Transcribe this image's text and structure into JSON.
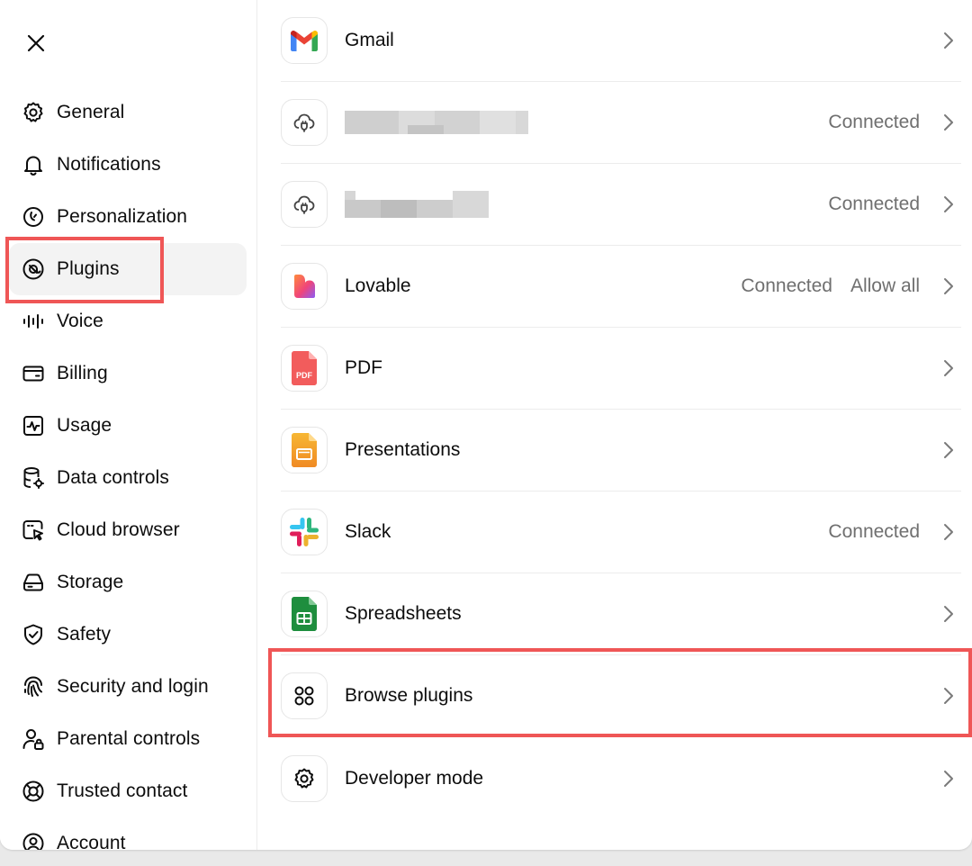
{
  "sidebar": {
    "items": [
      {
        "key": "general",
        "label": "General",
        "icon": "gear-icon"
      },
      {
        "key": "notifications",
        "label": "Notifications",
        "icon": "bell-icon"
      },
      {
        "key": "personalization",
        "label": "Personalization",
        "icon": "personalization-icon"
      },
      {
        "key": "plugins",
        "label": "Plugins",
        "icon": "plugins-icon",
        "active": true
      },
      {
        "key": "voice",
        "label": "Voice",
        "icon": "voice-wave-icon"
      },
      {
        "key": "billing",
        "label": "Billing",
        "icon": "credit-card-icon"
      },
      {
        "key": "usage",
        "label": "Usage",
        "icon": "usage-chart-icon"
      },
      {
        "key": "data-controls",
        "label": "Data controls",
        "icon": "database-gear-icon"
      },
      {
        "key": "cloud-browser",
        "label": "Cloud browser",
        "icon": "cloud-browser-icon"
      },
      {
        "key": "storage",
        "label": "Storage",
        "icon": "storage-drive-icon"
      },
      {
        "key": "safety",
        "label": "Safety",
        "icon": "shield-check-icon"
      },
      {
        "key": "security-and-login",
        "label": "Security and login",
        "icon": "fingerprint-icon"
      },
      {
        "key": "parental-controls",
        "label": "Parental controls",
        "icon": "user-lock-icon"
      },
      {
        "key": "trusted-contact",
        "label": "Trusted contact",
        "icon": "lifebuoy-icon"
      },
      {
        "key": "account",
        "label": "Account",
        "icon": "account-icon"
      }
    ]
  },
  "plugins": [
    {
      "key": "gmail",
      "name": "Gmail",
      "status": "",
      "icon": "gmail-icon"
    },
    {
      "key": "redacted-1",
      "name": "",
      "status": "Connected",
      "icon": "cloud-plugin-icon",
      "redacted": true
    },
    {
      "key": "redacted-2",
      "name": "",
      "status": "Connected",
      "icon": "cloud-plugin-icon",
      "redacted": true
    },
    {
      "key": "lovable",
      "name": "Lovable",
      "status": "Connected",
      "extra": "Allow all",
      "icon": "lovable-heart-icon"
    },
    {
      "key": "pdf",
      "name": "PDF",
      "status": "",
      "icon": "pdf-file-icon",
      "icon_text": "PDF"
    },
    {
      "key": "presentations",
      "name": "Presentations",
      "status": "",
      "icon": "presentation-icon"
    },
    {
      "key": "slack",
      "name": "Slack",
      "status": "Connected",
      "icon": "slack-icon"
    },
    {
      "key": "spreadsheets",
      "name": "Spreadsheets",
      "status": "",
      "icon": "spreadsheet-icon"
    },
    {
      "key": "browse-plugins",
      "name": "Browse plugins",
      "status": "",
      "icon": "grid-four-circles-icon"
    },
    {
      "key": "developer-mode",
      "name": "Developer mode",
      "status": "",
      "icon": "gear-icon"
    }
  ],
  "colors": {
    "highlight": "#ef5656",
    "active_bg": "#f3f3f3",
    "status_text": "#6f6f6f"
  }
}
